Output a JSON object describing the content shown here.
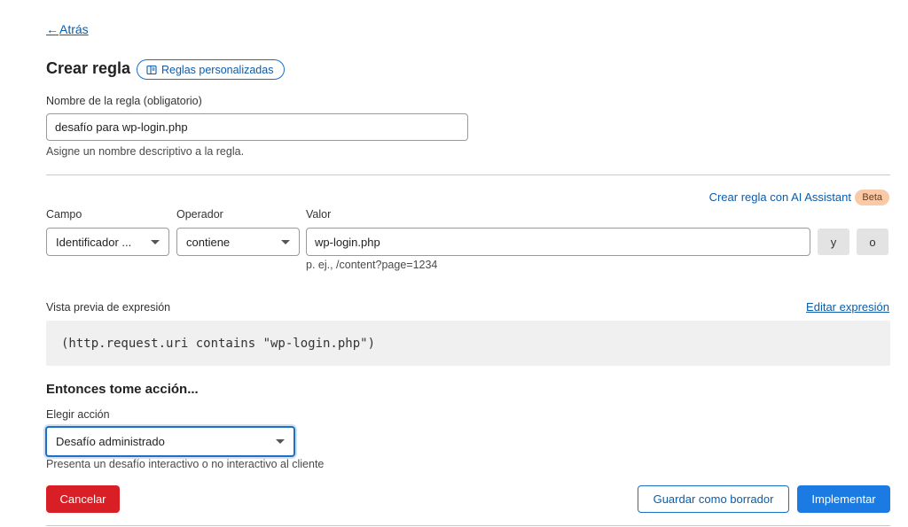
{
  "nav": {
    "back_arrow": "←",
    "back_label": "Atrás"
  },
  "header": {
    "title": "Crear regla",
    "custom_rules_label": "Reglas personalizadas",
    "custom_rules_icon": "book-icon"
  },
  "rule_name": {
    "label": "Nombre de la regla (obligatorio)",
    "value": "desafío para wp-login.php",
    "hint": "Asigne un nombre descriptivo a la regla."
  },
  "ai": {
    "link_label": "Crear regla con AI Assistant",
    "badge": "Beta"
  },
  "condition": {
    "field_label": "Campo",
    "field_value": "Identificador ...",
    "operator_label": "Operador",
    "operator_value": "contiene",
    "value_label": "Valor",
    "value": "wp-login.php",
    "value_hint": "p. ej., /content?page=1234",
    "and_label": "y",
    "or_label": "o"
  },
  "preview": {
    "label": "Vista previa de expresión",
    "edit_label": "Editar expresión",
    "expression": "(http.request.uri contains \"wp-login.php\")"
  },
  "action": {
    "section_title": "Entonces tome acción...",
    "label": "Elegir acción",
    "value": "Desafío administrado",
    "hint": "Presenta un desafío interactivo o no interactivo al cliente"
  },
  "footer": {
    "cancel_label": "Cancelar",
    "draft_label": "Guardar como borrador",
    "deploy_label": "Implementar"
  },
  "colors": {
    "accent": "#1b7be3",
    "danger": "#d91f26",
    "link": "#0b5cab",
    "beta_bg": "#f9c9a8"
  }
}
